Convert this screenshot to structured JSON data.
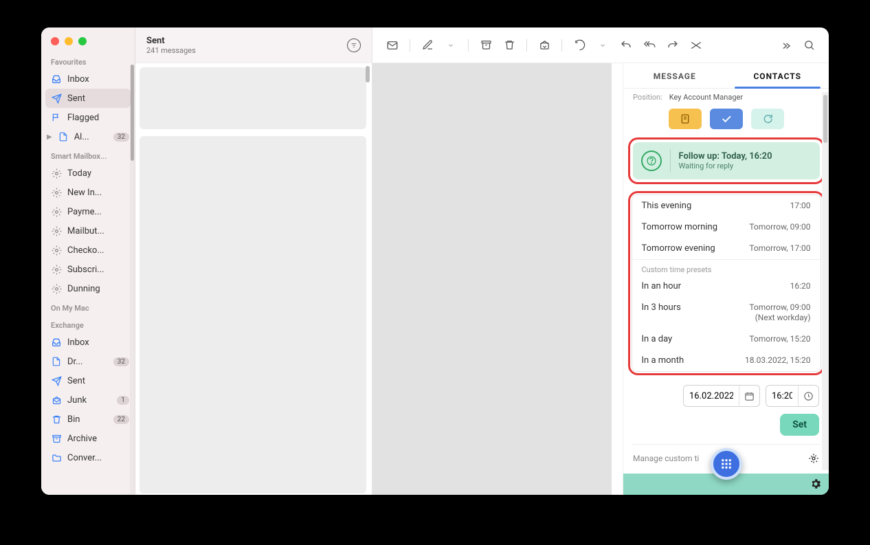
{
  "sidebar": {
    "sections": {
      "favourites": {
        "label": "Favourites",
        "items": [
          {
            "icon": "inbox-icon",
            "label": "Inbox"
          },
          {
            "icon": "paper-plane-icon",
            "label": "Sent",
            "active": true
          },
          {
            "icon": "flag-icon",
            "label": "Flagged"
          },
          {
            "icon": "file-icon",
            "label": "Al...",
            "badge": "32",
            "expandable": true
          }
        ]
      },
      "smart": {
        "label": "Smart Mailbox...",
        "items": [
          {
            "icon": "gear-icon",
            "label": "Today"
          },
          {
            "icon": "gear-icon",
            "label": "New In..."
          },
          {
            "icon": "gear-icon",
            "label": "Payme..."
          },
          {
            "icon": "gear-icon",
            "label": "Mailbut..."
          },
          {
            "icon": "gear-icon",
            "label": "Checko..."
          },
          {
            "icon": "gear-icon",
            "label": "Subscri..."
          },
          {
            "icon": "gear-icon",
            "label": "Dunning"
          }
        ]
      },
      "onmymac": {
        "label": "On My Mac"
      },
      "exchange": {
        "label": "Exchange",
        "items": [
          {
            "icon": "inbox-icon",
            "label": "Inbox"
          },
          {
            "icon": "file-icon",
            "label": "Dr...",
            "badge": "32"
          },
          {
            "icon": "paper-plane-icon",
            "label": "Sent"
          },
          {
            "icon": "junk-icon",
            "label": "Junk",
            "badge": "1"
          },
          {
            "icon": "trash-icon",
            "label": "Bin",
            "badge": "22"
          },
          {
            "icon": "archive-icon",
            "label": "Archive"
          },
          {
            "icon": "folder-icon",
            "label": "Conver..."
          }
        ]
      }
    }
  },
  "messageList": {
    "title": "Sent",
    "subtitle": "241 messages"
  },
  "inspector": {
    "tabs": {
      "message": "MESSAGE",
      "contacts": "CONTACTS"
    },
    "position_label": "Position:",
    "position_value": "Key Account Manager",
    "followup": {
      "title": "Follow up: Today, 16:20",
      "sub": "Waiting for reply"
    },
    "quick_presets": [
      {
        "label": "This evening",
        "time": "17:00"
      },
      {
        "label": "Tomorrow morning",
        "time": "Tomorrow, 09:00"
      },
      {
        "label": "Tomorrow evening",
        "time": "Tomorrow, 17:00"
      }
    ],
    "custom_presets_header": "Custom time presets",
    "custom_presets": [
      {
        "label": "In an hour",
        "time": "16:20"
      },
      {
        "label": "In 3 hours",
        "time": "Tomorrow, 09:00",
        "sub": "(Next workday)"
      },
      {
        "label": "In a day",
        "time": "Tomorrow, 15:20"
      },
      {
        "label": "In a month",
        "time": "18.03.2022, 15:20"
      }
    ],
    "date_value": "16.02.2022",
    "time_value": "16:20",
    "set_label": "Set",
    "manage_label": "Manage custom ti"
  }
}
